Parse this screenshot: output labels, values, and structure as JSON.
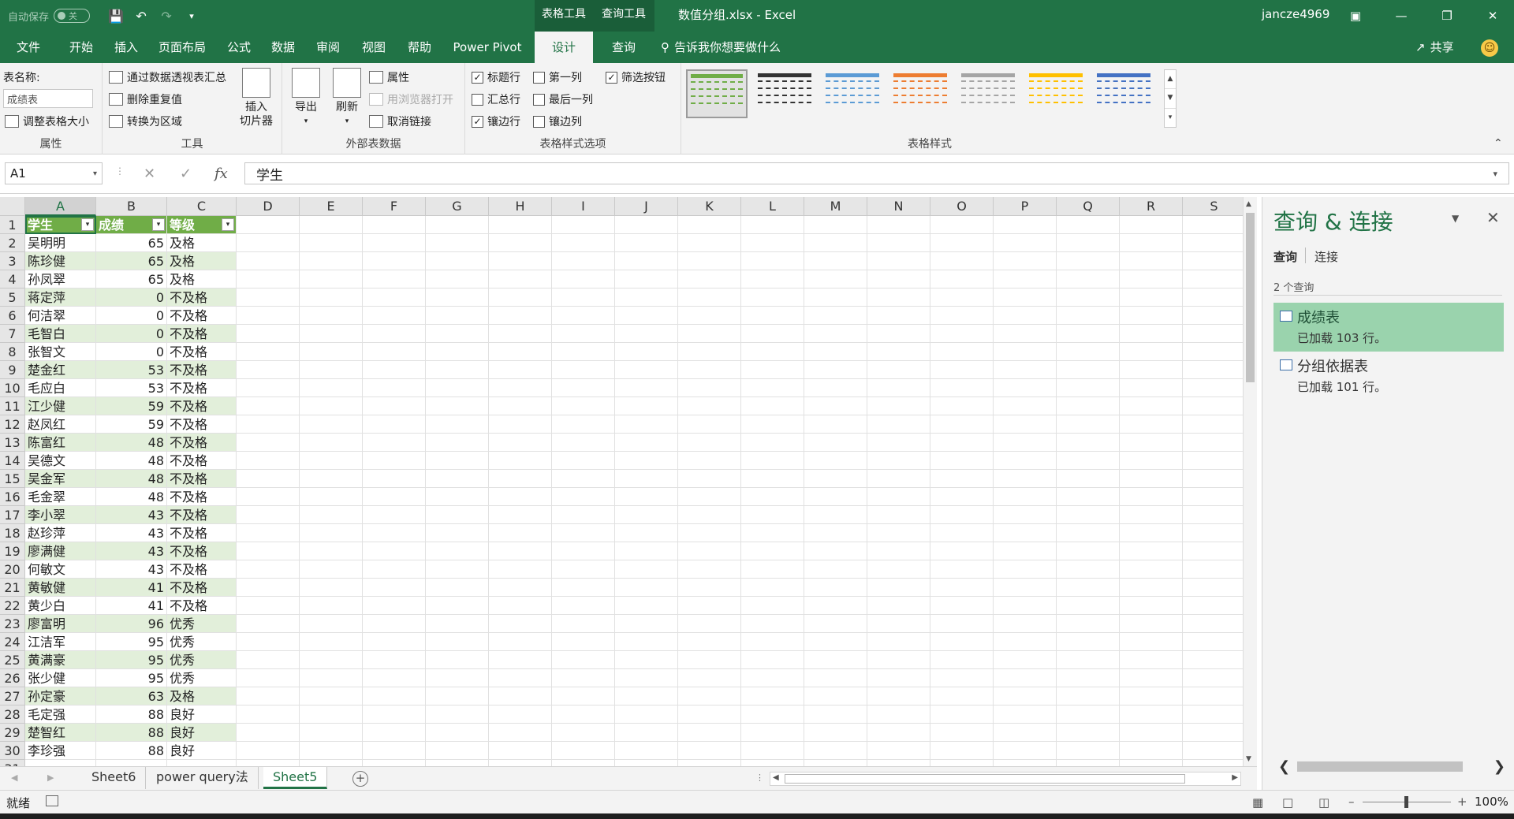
{
  "titlebar": {
    "autosave_label": "自动保存",
    "autosave_state": "关",
    "context_tab_table": "表格工具",
    "context_tab_query": "查询工具",
    "doc_title": "数值分组.xlsx  -  Excel",
    "username": "jancze4969"
  },
  "tabs": [
    "文件",
    "开始",
    "插入",
    "页面布局",
    "公式",
    "数据",
    "审阅",
    "视图",
    "帮助",
    "Power Pivot",
    "设计",
    "查询"
  ],
  "active_tab": "设计",
  "tell_me": "告诉我你想要做什么",
  "share": "共享",
  "ribbon": {
    "properties": {
      "table_name_label": "表名称:",
      "table_name_value": "成绩表",
      "resize": "调整表格大小",
      "group": "属性"
    },
    "tools": {
      "pivot": "通过数据透视表汇总",
      "remove_dup": "删除重复值",
      "convert": "转换为区域",
      "slicer": "插入\n切片器",
      "group": "工具"
    },
    "external": {
      "export": "导出",
      "refresh": "刷新",
      "properties": "属性",
      "open_browser": "用浏览器打开",
      "unlink": "取消链接",
      "group": "外部表数据"
    },
    "style_options": {
      "header_row": "标题行",
      "total_row": "汇总行",
      "banded_rows": "镶边行",
      "first_col": "第一列",
      "last_col": "最后一列",
      "banded_cols": "镶边列",
      "filter_btn": "筛选按钮",
      "group": "表格样式选项"
    },
    "styles": {
      "group": "表格样式",
      "colors": [
        "#70ad47",
        "#333333",
        "#5b9bd5",
        "#ed7d31",
        "#a5a5a5",
        "#ffc000",
        "#4472c4"
      ]
    }
  },
  "formula_bar": {
    "name_box": "A1",
    "formula": "学生"
  },
  "grid": {
    "columns": [
      "A",
      "B",
      "C",
      "D",
      "E",
      "F",
      "G",
      "H",
      "I",
      "J",
      "K",
      "L",
      "M",
      "N",
      "O",
      "P",
      "Q",
      "R",
      "S"
    ],
    "header_row": [
      "学生",
      "成绩",
      "等级"
    ],
    "rows": [
      [
        "吴明明",
        "65",
        "及格"
      ],
      [
        "陈珍健",
        "65",
        "及格"
      ],
      [
        "孙凤翠",
        "65",
        "及格"
      ],
      [
        "蒋定萍",
        "0",
        "不及格"
      ],
      [
        "何洁翠",
        "0",
        "不及格"
      ],
      [
        "毛智白",
        "0",
        "不及格"
      ],
      [
        "张智文",
        "0",
        "不及格"
      ],
      [
        "楚金红",
        "53",
        "不及格"
      ],
      [
        "毛应白",
        "53",
        "不及格"
      ],
      [
        "江少健",
        "59",
        "不及格"
      ],
      [
        "赵凤红",
        "59",
        "不及格"
      ],
      [
        "陈富红",
        "48",
        "不及格"
      ],
      [
        "吴德文",
        "48",
        "不及格"
      ],
      [
        "吴金军",
        "48",
        "不及格"
      ],
      [
        "毛金翠",
        "48",
        "不及格"
      ],
      [
        "李小翠",
        "43",
        "不及格"
      ],
      [
        "赵珍萍",
        "43",
        "不及格"
      ],
      [
        "廖满健",
        "43",
        "不及格"
      ],
      [
        "何敏文",
        "43",
        "不及格"
      ],
      [
        "黄敏健",
        "41",
        "不及格"
      ],
      [
        "黄少白",
        "41",
        "不及格"
      ],
      [
        "廖富明",
        "96",
        "优秀"
      ],
      [
        "江洁军",
        "95",
        "优秀"
      ],
      [
        "黄满豪",
        "95",
        "优秀"
      ],
      [
        "张少健",
        "95",
        "优秀"
      ],
      [
        "孙定豪",
        "63",
        "及格"
      ],
      [
        "毛定强",
        "88",
        "良好"
      ],
      [
        "楚智红",
        "88",
        "良好"
      ],
      [
        "李珍强",
        "88",
        "良好"
      ]
    ]
  },
  "sheets": [
    "Sheet6",
    "power query法",
    "Sheet5"
  ],
  "active_sheet": "Sheet5",
  "status": {
    "ready": "就绪",
    "zoom": "100%"
  },
  "queries_pane": {
    "title": "查询 & 连接",
    "tab_queries": "查询",
    "tab_connections": "连接",
    "count": "2 个查询",
    "items": [
      {
        "name": "成绩表",
        "status": "已加载 103 行。"
      },
      {
        "name": "分组依据表",
        "status": "已加载 101 行。"
      }
    ]
  }
}
